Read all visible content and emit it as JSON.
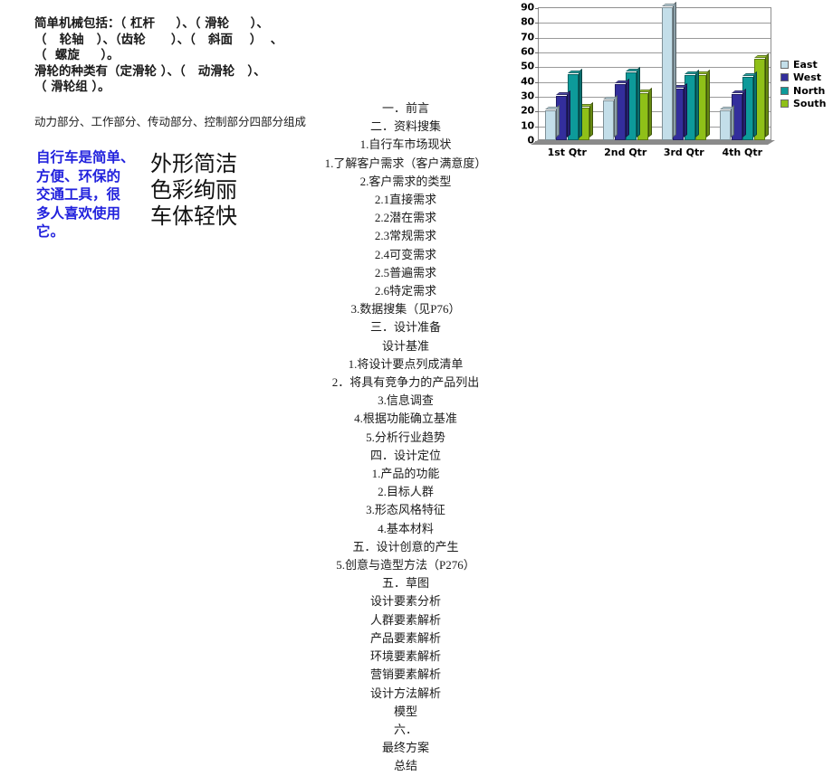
{
  "left": {
    "simple_machines": "简单机械包括：（ 杠杆     ）、（ 滑轮     ）、\n（   轮轴   ）、（齿轮      ）、（   斜面    ）  、\n（  螺旋     ）。\n滑轮的种类有（定滑轮 ）、（   动滑轮   ）、\n（ 滑轮组 ）。",
    "structure_line": "动力部分、工作部分、传动部分、控制部分四部分组成",
    "bicycle_intro": "自行车是简单、\n方便、环保的\n交通工具，很\n多人喜欢使用它。",
    "features": "外形简洁\n色彩绚丽\n车体轻快",
    "colors": {
      "bicycle_intro": "#2222dd",
      "features": "#111111"
    }
  },
  "outline": {
    "lines": [
      {
        "text": "一．前言",
        "sans": false
      },
      {
        "text": "二．资料搜集",
        "sans": false
      },
      {
        "text": "1.自行车市场现状",
        "sans": false
      },
      {
        "text": "1.了解客户需求（客户满意度）",
        "sans": false
      },
      {
        "text": "2.客户需求的类型",
        "sans": false
      },
      {
        "text": "2.1直接需求",
        "sans": false
      },
      {
        "text": "2.2潜在需求",
        "sans": false
      },
      {
        "text": "2.3常规需求",
        "sans": false
      },
      {
        "text": "2.4可变需求",
        "sans": false
      },
      {
        "text": "2.5普遍需求",
        "sans": false
      },
      {
        "text": "2.6特定需求",
        "sans": false
      },
      {
        "text": "3.数据搜集（见P76）",
        "sans": false
      },
      {
        "text": "三．设计准备",
        "sans": false
      },
      {
        "text": "设计基准",
        "sans": false
      },
      {
        "text": "1.将设计要点列成清单",
        "sans": false
      },
      {
        "text": "2．将具有竞争力的产品列出",
        "sans": false
      },
      {
        "text": "3.信息调查",
        "sans": false
      },
      {
        "text": "4.根据功能确立基准",
        "sans": false
      },
      {
        "text": "5.分析行业趋势",
        "sans": false
      },
      {
        "text": "四．设计定位",
        "sans": false
      },
      {
        "text": "1.产品的功能",
        "sans": false
      },
      {
        "text": "2.目标人群",
        "sans": false
      },
      {
        "text": "3.形态风格特征",
        "sans": false
      },
      {
        "text": "4.基本材料",
        "sans": false
      },
      {
        "text": "五．设计创意的产生",
        "sans": false
      },
      {
        "text": "5.创意与造型方法（P276）",
        "sans": false
      },
      {
        "text": "五．草图",
        "sans": false
      },
      {
        "text": "设计要素分析",
        "sans": false
      },
      {
        "text": "人群要素解析",
        "sans": false
      },
      {
        "text": "产品要素解析",
        "sans": false
      },
      {
        "text": "环境要素解析",
        "sans": false
      },
      {
        "text": "营销要素解析",
        "sans": false
      },
      {
        "text": "设计方法解析",
        "sans": false
      },
      {
        "text": "模型",
        "sans": false
      },
      {
        "text": "六．",
        "sans": false
      },
      {
        "text": "最终方案",
        "sans": false
      },
      {
        "text": "总结",
        "sans": false
      }
    ]
  },
  "chart_data": {
    "type": "bar",
    "title": "",
    "xlabel": "",
    "ylabel": "",
    "categories": [
      "1st Qtr",
      "2nd Qtr",
      "3rd Qtr",
      "4th Qtr"
    ],
    "series": [
      {
        "name": "East",
        "color": "#c3dee9",
        "values": [
          20,
          27,
          90,
          20
        ]
      },
      {
        "name": "West",
        "color": "#332e9c",
        "values": [
          30,
          38,
          35,
          31
        ]
      },
      {
        "name": "North",
        "color": "#0d9a9a",
        "values": [
          45,
          46,
          44,
          43
        ]
      },
      {
        "name": "South",
        "color": "#8fc018",
        "values": [
          22,
          32,
          44,
          55
        ]
      }
    ],
    "ylim": [
      0,
      90
    ],
    "yticks": [
      0,
      10,
      20,
      30,
      40,
      50,
      60,
      70,
      80,
      90
    ],
    "grid": true,
    "legend_position": "right"
  }
}
